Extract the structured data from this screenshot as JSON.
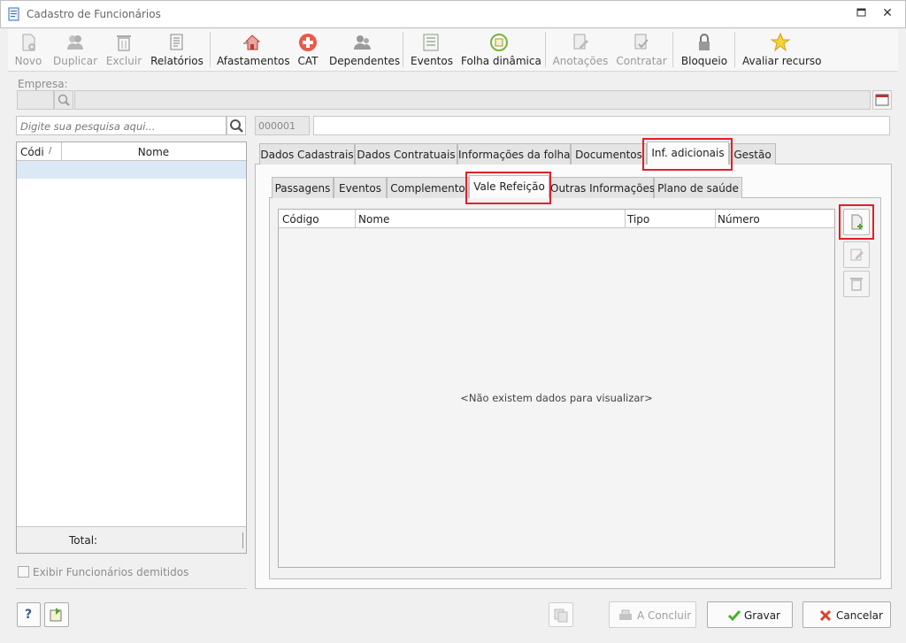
{
  "window": {
    "title": "Cadastro de Funcionários"
  },
  "toolbar": {
    "novo": "Novo",
    "duplicar": "Duplicar",
    "excluir": "Excluir",
    "relatorios": "Relatórios",
    "afastamentos": "Afastamentos",
    "cat": "CAT",
    "dependentes": "Dependentes",
    "eventos": "Eventos",
    "folha_dinamica": "Folha dinâmica",
    "anotacoes": "Anotações",
    "contratar": "Contratar",
    "bloqueio": "Bloqueio",
    "avaliar_recurso": "Avaliar recurso"
  },
  "empresa": {
    "label": "Empresa:"
  },
  "search": {
    "placeholder": "Digite sua pesquisa aqui..."
  },
  "record": {
    "code": "000001",
    "name": ""
  },
  "employee_grid": {
    "columns": [
      "Códi",
      "Nome"
    ],
    "sort_indicator": "/",
    "total_label": "Total:"
  },
  "exibir_demitidos": "Exibir Funcionários demitidos",
  "tabs": [
    "Dados Cadastrais",
    "Dados Contratuais",
    "Informações da folha",
    "Documentos",
    "Inf. adicionais",
    "Gestão"
  ],
  "subtabs": [
    "Passagens",
    "Eventos",
    "Complemento",
    "Vale Refeição",
    "Outras Informações",
    "Plano de saúde"
  ],
  "vr_grid": {
    "columns": [
      "Código",
      "Nome",
      "Tipo",
      "Número"
    ],
    "empty_message": "<Não existem dados para visualizar>"
  },
  "buttons": {
    "help": "?",
    "a_concluir": "A Concluir",
    "gravar": "Gravar",
    "cancelar": "Cancelar"
  },
  "colors": {
    "highlight": "#e0202a",
    "selection": "#dbe8f6"
  }
}
